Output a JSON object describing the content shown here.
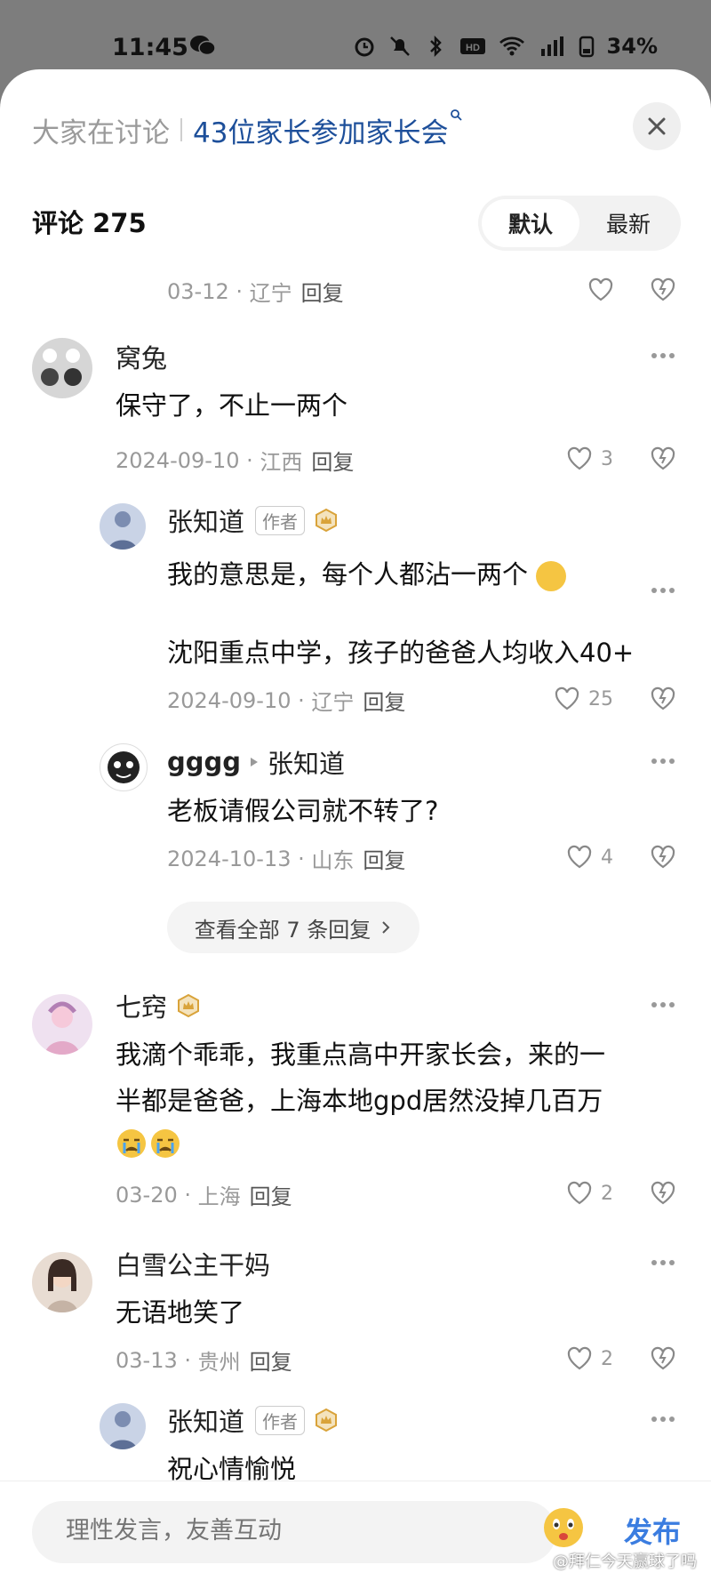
{
  "status_bar": {
    "time": "11:45",
    "battery": "34%"
  },
  "header": {
    "label": "大家在讨论",
    "topic": "43位家长参加家长会"
  },
  "comments_header": {
    "title": "评论 275",
    "sort_default": "默认",
    "sort_latest": "最新"
  },
  "prev_comment": {
    "date": "03-12",
    "location": "辽宁",
    "reply": "回复"
  },
  "comments": [
    {
      "name": "窝兔",
      "text": "保守了，不止一两个",
      "date": "2024-09-10",
      "location": "江西",
      "reply": "回复",
      "likes": "3"
    },
    {
      "name": "张知道",
      "author_badge": "作者",
      "text1": "我的意思是，每个人都沾一两个",
      "text2": "沈阳重点中学，孩子的爸爸人均收入40+",
      "date": "2024-09-10",
      "location": "辽宁",
      "reply": "回复",
      "likes": "25"
    },
    {
      "name": "gggg",
      "reply_to": "张知道",
      "text": "老板请假公司就不转了?",
      "date": "2024-10-13",
      "location": "山东",
      "reply": "回复",
      "likes": "4"
    },
    {
      "name": "七窍",
      "text1": "我滴个乖乖，我重点高中开家长会，来的一",
      "text2": "半都是爸爸，上海本地gpd居然没掉几百万",
      "date": "03-20",
      "location": "上海",
      "reply": "回复",
      "likes": "2"
    },
    {
      "name": "白雪公主干妈",
      "text": "无语地笑了",
      "date": "03-13",
      "location": "贵州",
      "reply": "回复",
      "likes": "2"
    },
    {
      "name": "张知道",
      "author_badge": "作者",
      "text": "祝心情愉悦"
    }
  ],
  "view_all": "查看全部 7 条回复",
  "bottom_bar": {
    "placeholder": "理性发言，友善互动",
    "send": "发布"
  },
  "watermark": "@拜仁今天赢球了吗",
  "colors": {
    "link_blue": "#1d4f9a",
    "send_blue": "#3b7de0",
    "crown_gold": "#d9a33a"
  }
}
